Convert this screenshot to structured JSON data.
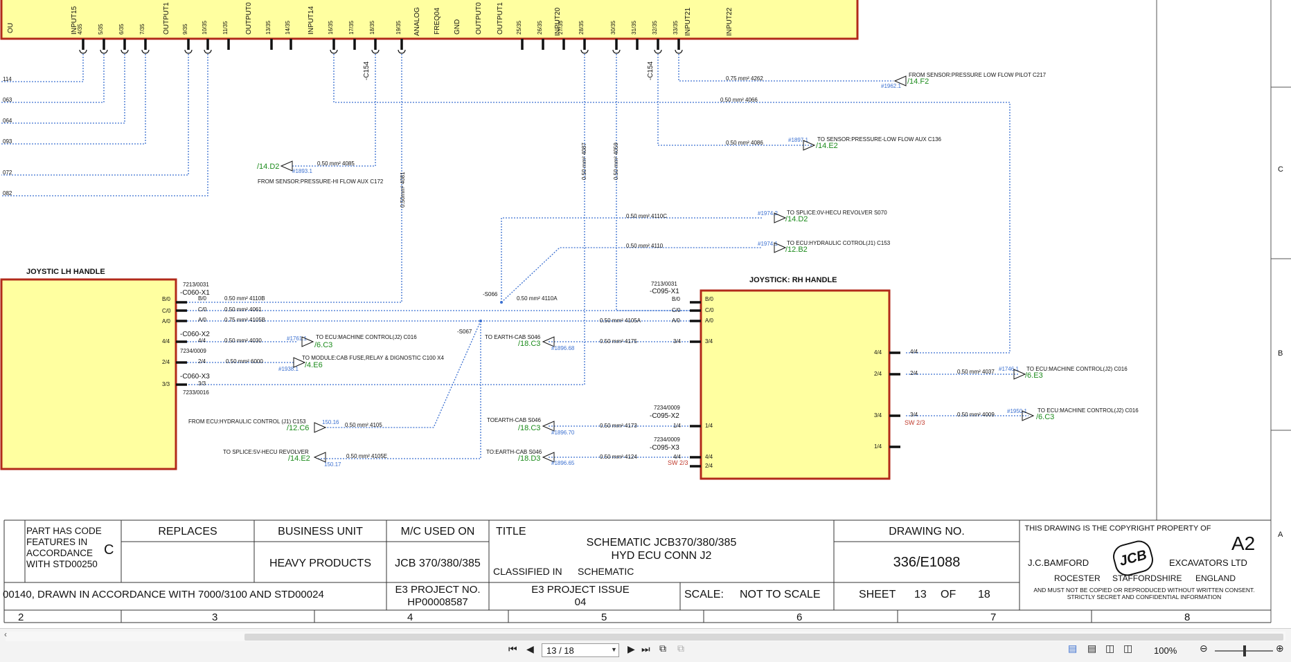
{
  "top_pins": {
    "labels": [
      "OU",
      "INPUT15",
      "OUTPUT1",
      "OUTPUT0",
      "INPUT14",
      "ANALOG",
      "FREQ04",
      "GND",
      "OUTPUT0",
      "OUTPUT1",
      "INPUT20",
      "INPUT21",
      "INPUT22"
    ],
    "numbers": [
      "4/35",
      "5/35",
      "6/35",
      "7/35",
      "9/35",
      "10/35",
      "11/35",
      "13/35",
      "14/35",
      "16/35",
      "17/35",
      "18/35",
      "19/35",
      "25/35",
      "26/35",
      "27/35",
      "28/35",
      "30/35",
      "31/35",
      "32/35",
      "33/35"
    ]
  },
  "left_offpage": [
    "114",
    "063",
    "064",
    "093",
    "072",
    "082"
  ],
  "wire_labels": {
    "low_flow_pilot": "0.75 mm² 4262",
    "w4066": "0.50 mm² 4066",
    "w4086": "0.50 mm² 4086",
    "w4085": "0.50 mm² 4085",
    "w4087": "0.50 mm² 4087",
    "w4059": "0.50 mm² 4059",
    "w4081": "0.50mm² 4081",
    "w4110c": "0.50 mm² 4110C",
    "w4110": "0.50 mm² 4110",
    "w4110b": "0.50 mm² 4110B",
    "w4061": "0.50 mm² 4061",
    "w4105b": "0.75 mm² 4105B",
    "w4110a": "0.50 mm² 4110A",
    "w4105a": "0.50 mm² 4105A",
    "w4175": "0.50 mm² 4175",
    "w4030": "0.50 mm² 4030",
    "w6000": "0.50 mm² 6000",
    "w4105": "0.50 mm² 4105",
    "w4173": "0.50 mm² 4173",
    "w4105e": "0.50 mm² 4105E",
    "w4124": "0.50 mm² 4124",
    "w4037": "0.50 mm² 4037",
    "w4009": "0.50 mm² 4009"
  },
  "connectors": {
    "c154": "-C154",
    "c060x1": "-C060-X1",
    "c060x2": "-C060-X2",
    "c060x3": "-C060-X3",
    "c095x1": "-C095-X1",
    "c095x2": "-C095-X2",
    "c095x3": "-C095-X3",
    "s066": "-S066",
    "s067": "-S067",
    "p7213": "7213/0031",
    "p7234": "7234/0009",
    "p7233": "7233/0016"
  },
  "components": {
    "lh_handle": "JOYSTIC LH HANDLE",
    "rh_handle": "JOYSTICK: RH HANDLE"
  },
  "pins": {
    "b0": "B/0",
    "c0": "C/0",
    "a0": "A/0",
    "p44": "4/4",
    "p24": "2/4",
    "p33": "3/3",
    "p34": "3/4",
    "p14": "1/4"
  },
  "refs": {
    "r14f2": "/14.F2",
    "r14e2": "/14.E2",
    "r14d2": "/14.D2",
    "r12b2": "/12.B2",
    "r6c3": "/6.C3",
    "r4e6": "/4.E6",
    "r18c3": "/18.C3",
    "r12c6": "/12.C6",
    "r18d3": "/18.D3",
    "r6e3": "/6.E3",
    "b19621": "#1962.1",
    "b18971": "#1897.1",
    "b18931": "#1893.1",
    "b19742": "#1974.2",
    "b19741": "#1974.1",
    "b17611": "#1761.1",
    "b19381": "#1938.1",
    "b189668": "#1896.68",
    "b15016": "150.16",
    "b189670": "#1896.70",
    "b15017": "150.17",
    "b189665": "#1896.65",
    "b17461": "#1746.1",
    "b19501": "#1950.1",
    "sw23": "SW 2/3"
  },
  "destinations": {
    "pressure_low_flow_pilot": "FROM SENSOR:PRESSURE LOW FLOW PILOT C217",
    "pressure_low_flow_aux": "TO SENSOR:PRESSURE-LOW FLOW AUX C136",
    "pressure_hi_flow_aux": "FROM SENSOR:PRESSURE-HI FLOW AUX C172",
    "splice_0v": "TO SPLICE:0V-HECU REVOLVER S070",
    "ecu_hyd_c153": "TO ECU:HYDRAULIC COTROL(J1) C153",
    "ecu_machine_c016": "TO ECU:MACHINE CONTROL(J2) C016",
    "module_cab_fuse": "TO MODULE:CAB FUSE,RELAY & DIGNOSTIC C100 X4",
    "earth_cab_s046": "TO EARTH-CAB S046",
    "from_ecu_hyd": "FROM ECU:HYDRAULIC CONTROL (J1) C153",
    "toearth_cab": "TOEARTH-CAB S046",
    "splice_5v": "TO SPLICE:5V-HECU REVOLVER",
    "to_earth_cab2": "TO:EARTH-CAB S046"
  },
  "row_labels": [
    "C",
    "B",
    "A"
  ],
  "column_numbers": [
    "2",
    "3",
    "4",
    "5",
    "6",
    "7",
    "8"
  ],
  "title_block": {
    "part_code": "PART HAS CODE FEATURES IN ACCORDANCE WITH STD00250",
    "part_code_letter": "C",
    "replaces": "REPLACES",
    "business_unit": "BUSINESS UNIT",
    "business_unit_value": "HEAVY PRODUCTS",
    "mc_used_on": "M/C USED ON",
    "mc_used_on_value": "JCB 370/380/385",
    "title_label": "TITLE",
    "title_line1": "SCHEMATIC JCB370/380/385",
    "title_line2": "HYD ECU CONN J2",
    "classified_in": "CLASSIFIED IN",
    "classified_value": "SCHEMATIC",
    "drawing_no_label": "DRAWING NO.",
    "drawing_no": "336/E1088",
    "copyright": "THIS DRAWING IS THE COPYRIGHT PROPERTY OF",
    "size": "A2",
    "company_left": "J.C.BAMFORD",
    "company_right": "EXCAVATORS LTD",
    "logo": "JCB",
    "loc1": "ROCESTER",
    "loc2": "STAFFORDSHIRE",
    "loc3": "ENGLAND",
    "legal1": "AND MUST NOT BE COPIED OR REPRODUCED WITHOUT WRITTEN CONSENT.",
    "legal2": "STRICTLY SECRET AND CONFIDENTIAL INFORMATION",
    "drawn_note": "00140, DRAWN IN ACCORDANCE WITH 7000/3100 AND STD00024",
    "e3_project_no_label": "E3 PROJECT NO.",
    "e3_project_no": "HP00008587",
    "e3_project_issue_label": "E3 PROJECT ISSUE",
    "e3_project_issue": "04",
    "scale_label": "SCALE:",
    "scale_value": "NOT TO SCALE",
    "sheet_label": "SHEET",
    "sheet_no": "13",
    "of_label": "OF",
    "sheet_total": "18"
  },
  "viewer": {
    "page_indicator": "13 / 18",
    "zoom": "100%"
  },
  "colors": {
    "box_fill": "#ffffa0",
    "box_stroke": "#b22a1a",
    "wire": "#3a6fd0",
    "ref_green": "#1a8a1a"
  }
}
